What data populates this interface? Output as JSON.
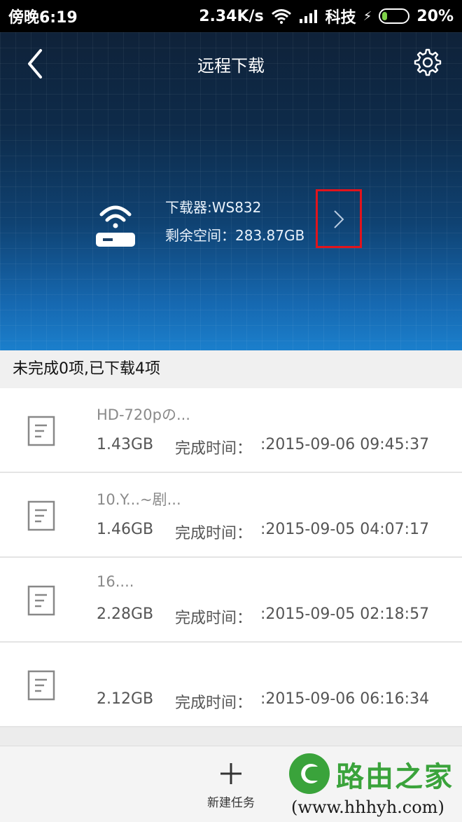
{
  "status_bar": {
    "time": "傍晚6:19",
    "speed": "2.34K/s",
    "carrier": "科技",
    "battery": "20%",
    "battery_level": 0.2
  },
  "header": {
    "title": "远程下载"
  },
  "device": {
    "name": "下载器:WS832",
    "space": "剩余空间：283.87GB"
  },
  "summary": "未完成0项,已下载4项",
  "files": [
    {
      "name": "HD-720pの...",
      "size": "1.43GB",
      "time_label": "完成时间：",
      "time": ":2015-09-06 09:45:37"
    },
    {
      "name": "10.Y...~剧...",
      "size": "1.46GB",
      "time_label": "完成时间：",
      "time": ":2015-09-05 04:07:17"
    },
    {
      "name": "16....",
      "size": "2.28GB",
      "time_label": "完成时间：",
      "time": ":2015-09-05 02:18:57"
    },
    {
      "name": "",
      "size": "2.12GB",
      "time_label": "完成时间：",
      "time": ":2015-09-06 06:16:34"
    }
  ],
  "bottom_bar": {
    "new_task_label": "新建任务"
  },
  "watermark": {
    "brand": "路由之家",
    "url": "(www.hhhyh.com)"
  },
  "colors": {
    "highlight_box": "#e1141c",
    "watermark_green": "#3aa33b"
  }
}
